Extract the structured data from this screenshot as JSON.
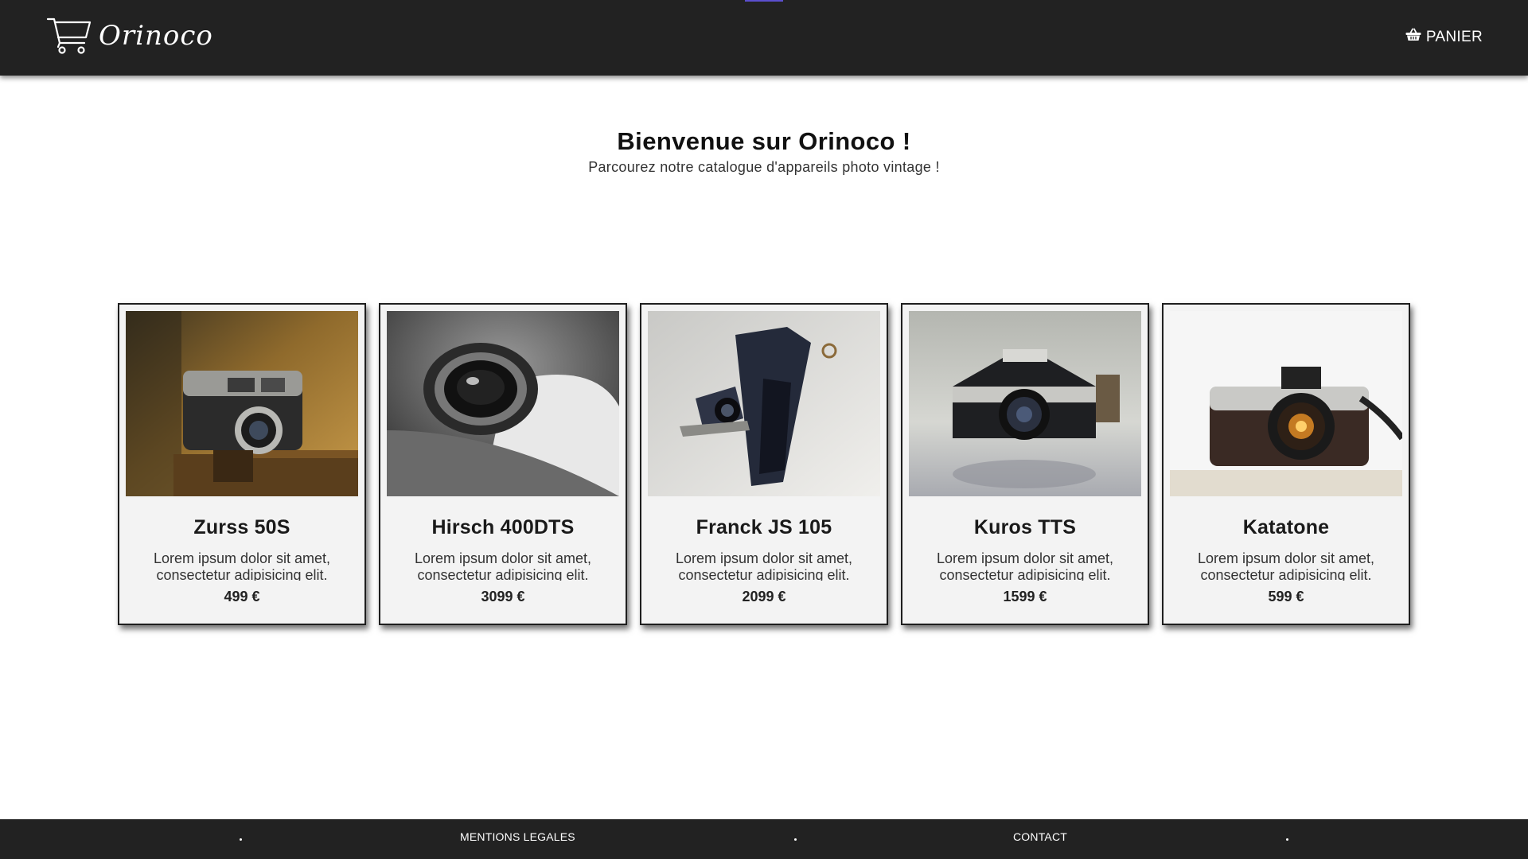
{
  "header": {
    "brand_name": "Orinoco",
    "cart_label": "PANIER",
    "accent_color": "#5b4fcf",
    "background_color": "#222222"
  },
  "hero": {
    "title": "Bienvenue sur Orinoco !",
    "subtitle": "Parcourez notre catalogue d'appareils photo vintage !"
  },
  "products": [
    {
      "name": "Zurss 50S",
      "description": "Lorem ipsum dolor sit amet, consectetur adipisicing elit.",
      "price": "499 €"
    },
    {
      "name": "Hirsch 400DTS",
      "description": "Lorem ipsum dolor sit amet, consectetur adipisicing elit.",
      "price": "3099 €"
    },
    {
      "name": "Franck JS 105",
      "description": "Lorem ipsum dolor sit amet, consectetur adipisicing elit.",
      "price": "2099 €"
    },
    {
      "name": "Kuros TTS",
      "description": "Lorem ipsum dolor sit amet, consectetur adipisicing elit.",
      "price": "1599 €"
    },
    {
      "name": "Katatone",
      "description": "Lorem ipsum dolor sit amet, consectetur adipisicing elit.",
      "price": "599 €"
    }
  ],
  "footer": {
    "links": [
      "MENTIONS LEGALES",
      "CONTACT"
    ],
    "separator": "."
  },
  "icons": {
    "logo": "shopping-cart-icon",
    "cart": "shopping-basket-icon"
  }
}
